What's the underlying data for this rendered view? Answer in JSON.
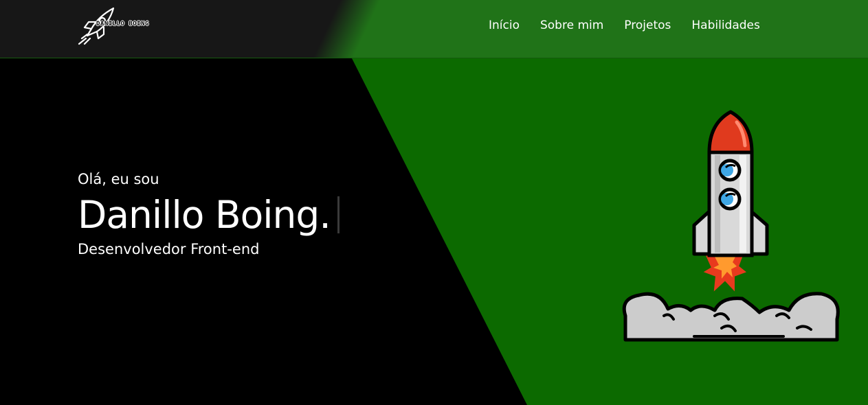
{
  "header": {
    "logo_text": "DANILLO BOING",
    "nav": [
      {
        "label": "Início"
      },
      {
        "label": "Sobre mim"
      },
      {
        "label": "Projetos"
      },
      {
        "label": "Habilidades"
      }
    ]
  },
  "hero": {
    "greeting": "Olá, eu sou",
    "name": "Danillo Boing.",
    "role": "Desenvolvedor Front-end"
  },
  "colors": {
    "green_bg": "#0c6a00",
    "header_green": "#207318",
    "header_dark": "#171717",
    "black": "#000000",
    "rocket_red": "#e03a1e",
    "rocket_body": "#d9d9d9",
    "smoke": "#cccccc"
  }
}
